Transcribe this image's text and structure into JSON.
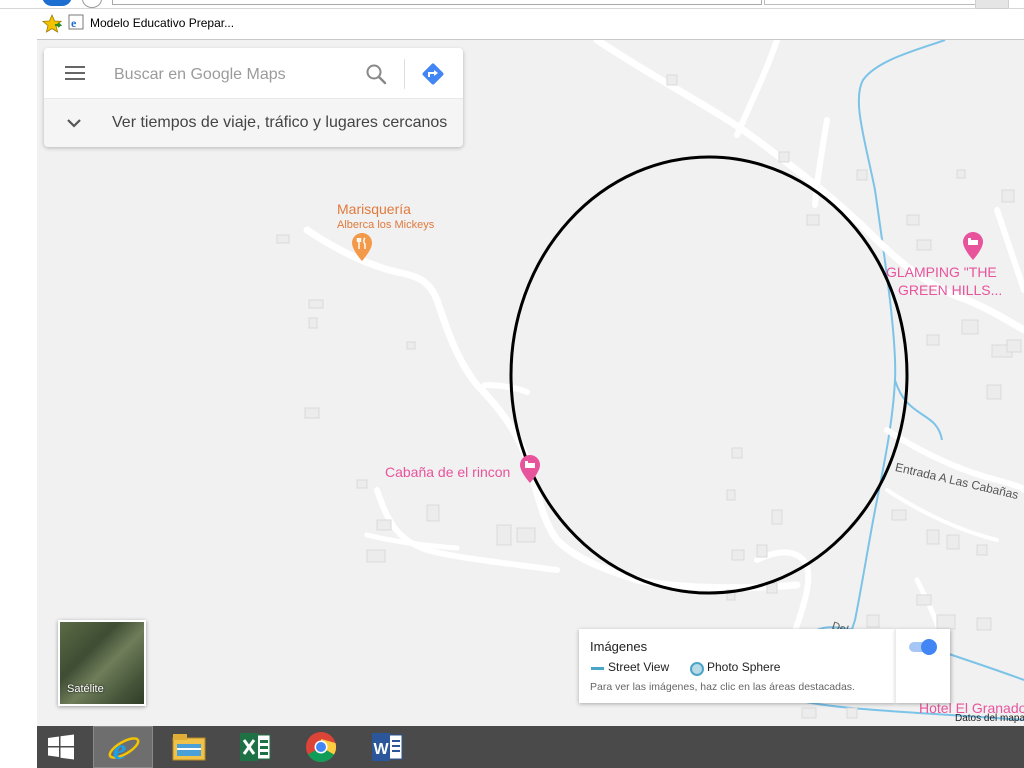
{
  "browser": {
    "favorites_bar": {
      "item_label": "Modelo Educativo Prepar..."
    }
  },
  "maps": {
    "search": {
      "placeholder": "Buscar en Google Maps",
      "value": ""
    },
    "travel_row_label": "Ver tiempos de viaje, tráfico y lugares cercanos",
    "places": {
      "marisqueria_title": "Marisquería",
      "marisqueria_sub": "Alberca los Mickeys",
      "cabana": "Cabaña de el rincon",
      "glamping_line1": "GLAMPING \"THE",
      "glamping_line2": "GREEN HILLS...",
      "road_label": "Entrada A Las Cabañas",
      "hotel": "Hotel El Granado",
      "del_label": "Del"
    },
    "satellite_label": "Satélite",
    "imagery": {
      "title": "Imágenes",
      "street_view": "Street View",
      "photo_sphere": "Photo Sphere",
      "hint": "Para ver las imágenes, haz clic en las áreas destacadas.",
      "toggle_on": true
    },
    "map_data_label": "Datos del mapa"
  },
  "colors": {
    "map_background": "#f1f1f1",
    "road": "#ffffff",
    "water": "#7cc3e8",
    "restaurant_label": "#e07a3c",
    "lodging_label": "#e8549c",
    "accent_blue": "#4285f4",
    "taskbar": "#4a4a4a"
  },
  "taskbar": {
    "items": [
      "windows-start-icon",
      "internet-explorer-icon",
      "file-explorer-icon",
      "excel-icon",
      "chrome-icon",
      "word-icon"
    ]
  }
}
